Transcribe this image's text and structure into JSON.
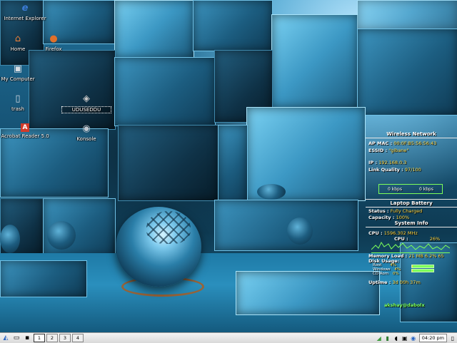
{
  "desktop_icons": [
    {
      "id": "ie",
      "label": "Internet Explorer",
      "icon": "internet-explorer-icon",
      "glyph": "e",
      "color": "#3b7bd6",
      "boxed": false
    },
    {
      "id": "home",
      "label": "Home",
      "icon": "home-icon",
      "glyph": "⌂",
      "color": "#e8803a",
      "boxed": false
    },
    {
      "id": "firefox",
      "label": "Firefox",
      "icon": "firefox-icon",
      "glyph": "●",
      "color": "#e0702a",
      "boxed": false
    },
    {
      "id": "computer",
      "label": "My Computer",
      "icon": "computer-icon",
      "glyph": "▣",
      "color": "#d8dde3",
      "boxed": false
    },
    {
      "id": "trash",
      "label": "trash",
      "icon": "trash-icon",
      "glyph": "▯",
      "color": "#cfd8e0",
      "boxed": false
    },
    {
      "id": "uduseddu",
      "label": "UDUSEDDU",
      "icon": "program-icon",
      "glyph": "◈",
      "color": "#c7c7c7",
      "boxed": true
    },
    {
      "id": "acrobat",
      "label": "Acrobat Reader 5.0",
      "icon": "acrobat-reader-icon",
      "glyph": "A",
      "color": "#d23b2a",
      "boxed": false
    },
    {
      "id": "konsole",
      "label": "Konsole",
      "icon": "konsole-icon",
      "glyph": "◉",
      "color": "#bfc7cf",
      "boxed": false
    }
  ],
  "conky": {
    "wireless": {
      "title": "Wireless Network",
      "ap_mac_key": "AP MAC :",
      "ap_mac": "00:0F:B5:56:56:43",
      "essid_key": "ESSID :",
      "essid": "\"gibane\"",
      "ip_key": "IP :",
      "ip": "192.168.0.3",
      "link_key": "Link Quality :",
      "link": "97/100",
      "down": "0 kbps",
      "up": "0 kbps"
    },
    "battery": {
      "title": "Laptop Battery",
      "status_key": "Status :",
      "status": "Fully Charged",
      "capacity_key": "Capacity :",
      "capacity": "100%"
    },
    "system": {
      "title": "System Info",
      "cpu_key": "CPU :",
      "cpu_freq": "1596.302",
      "cpu_freq_unit": "MHz",
      "cpu_usage_key": "CPU :",
      "cpu_usage": "26%",
      "mem_key": "Memory Load :",
      "mem": "21 MB 6.2%",
      "mem_suffix": "65",
      "disk_key": "Disk Usage:",
      "disks": [
        {
          "name": "Root",
          "value": "4%",
          "fill": 0.04
        },
        {
          "name": "Windows",
          "value": "4%",
          "fill": 0.04
        },
        {
          "name": "CD Rom",
          "value": "0%",
          "fill": 0.0
        }
      ],
      "uptime_key": "Uptime :",
      "uptime": "3d 00h 37m"
    },
    "signature": "akshay@dabolx"
  },
  "taskbar": {
    "workspaces": [
      "1",
      "2",
      "3",
      "4"
    ],
    "active_workspace": "1",
    "clock": "04:20 pm"
  }
}
